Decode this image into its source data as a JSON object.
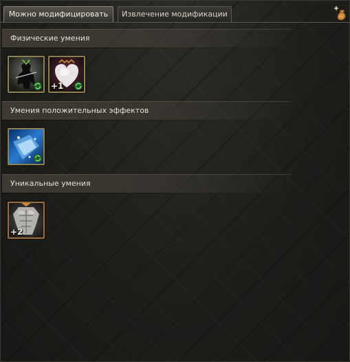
{
  "tabs": [
    {
      "label": "Можно модифицировать",
      "active": true
    },
    {
      "label": "Извлечение модификации",
      "active": false
    }
  ],
  "corner_icon": "add-sack-icon",
  "sections": [
    {
      "title": "Физические умения",
      "skills": [
        {
          "icon": "dark-warrior-skill-icon",
          "badge": "refresh-icon",
          "level": ""
        },
        {
          "icon": "heart-shield-skill-icon",
          "badge": "refresh-icon",
          "level": "+1"
        }
      ]
    },
    {
      "title": "Умения положительных эффектов",
      "skills": [
        {
          "icon": "ice-crystal-skill-icon",
          "badge": "refresh-icon",
          "level": ""
        }
      ]
    },
    {
      "title": "Уникальные умения",
      "skills": [
        {
          "icon": "muscle-torso-skill-icon",
          "badge": "",
          "level": "+2"
        }
      ]
    }
  ],
  "colors": {
    "skill_border": "#8d8150",
    "unique_border": "#9a6e3c",
    "badge_green": "#3fae4a"
  }
}
